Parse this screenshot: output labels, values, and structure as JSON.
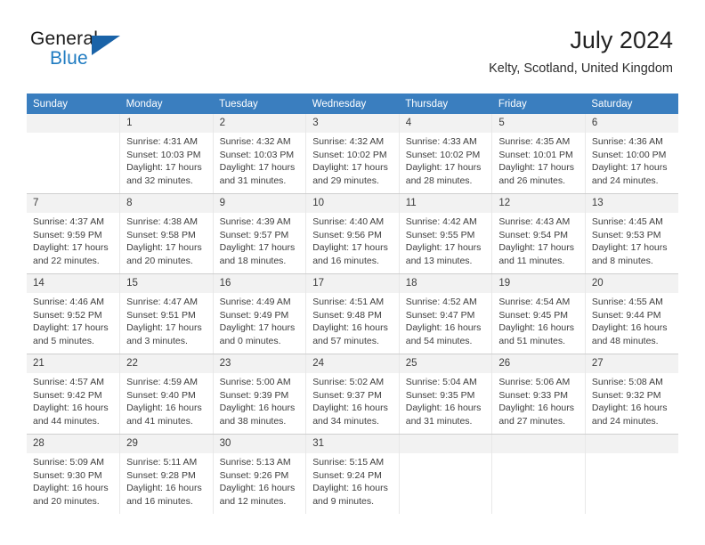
{
  "brand": {
    "name_part1": "General",
    "name_part2": "Blue",
    "logo_icon": "triangle-logo-icon",
    "accent_color": "#1f7bc1",
    "logo_triangle_color": "#1a63a8"
  },
  "header": {
    "title": "July 2024",
    "subtitle": "Kelty, Scotland, United Kingdom"
  },
  "calendar": {
    "header_bg_color": "#3a7ebf",
    "daynum_bg_color": "#f2f2f2",
    "weekday_headers": [
      "Sunday",
      "Monday",
      "Tuesday",
      "Wednesday",
      "Thursday",
      "Friday",
      "Saturday"
    ],
    "labels": {
      "sunrise": "Sunrise:",
      "sunset": "Sunset:",
      "daylight": "Daylight:"
    },
    "weeks": [
      [
        {
          "day": "",
          "blank": true
        },
        {
          "day": "1",
          "sunrise": "Sunrise: 4:31 AM",
          "sunset": "Sunset: 10:03 PM",
          "daylight_1": "Daylight: 17 hours",
          "daylight_2": "and 32 minutes."
        },
        {
          "day": "2",
          "sunrise": "Sunrise: 4:32 AM",
          "sunset": "Sunset: 10:03 PM",
          "daylight_1": "Daylight: 17 hours",
          "daylight_2": "and 31 minutes."
        },
        {
          "day": "3",
          "sunrise": "Sunrise: 4:32 AM",
          "sunset": "Sunset: 10:02 PM",
          "daylight_1": "Daylight: 17 hours",
          "daylight_2": "and 29 minutes."
        },
        {
          "day": "4",
          "sunrise": "Sunrise: 4:33 AM",
          "sunset": "Sunset: 10:02 PM",
          "daylight_1": "Daylight: 17 hours",
          "daylight_2": "and 28 minutes."
        },
        {
          "day": "5",
          "sunrise": "Sunrise: 4:35 AM",
          "sunset": "Sunset: 10:01 PM",
          "daylight_1": "Daylight: 17 hours",
          "daylight_2": "and 26 minutes."
        },
        {
          "day": "6",
          "sunrise": "Sunrise: 4:36 AM",
          "sunset": "Sunset: 10:00 PM",
          "daylight_1": "Daylight: 17 hours",
          "daylight_2": "and 24 minutes."
        }
      ],
      [
        {
          "day": "7",
          "sunrise": "Sunrise: 4:37 AM",
          "sunset": "Sunset: 9:59 PM",
          "daylight_1": "Daylight: 17 hours",
          "daylight_2": "and 22 minutes."
        },
        {
          "day": "8",
          "sunrise": "Sunrise: 4:38 AM",
          "sunset": "Sunset: 9:58 PM",
          "daylight_1": "Daylight: 17 hours",
          "daylight_2": "and 20 minutes."
        },
        {
          "day": "9",
          "sunrise": "Sunrise: 4:39 AM",
          "sunset": "Sunset: 9:57 PM",
          "daylight_1": "Daylight: 17 hours",
          "daylight_2": "and 18 minutes."
        },
        {
          "day": "10",
          "sunrise": "Sunrise: 4:40 AM",
          "sunset": "Sunset: 9:56 PM",
          "daylight_1": "Daylight: 17 hours",
          "daylight_2": "and 16 minutes."
        },
        {
          "day": "11",
          "sunrise": "Sunrise: 4:42 AM",
          "sunset": "Sunset: 9:55 PM",
          "daylight_1": "Daylight: 17 hours",
          "daylight_2": "and 13 minutes."
        },
        {
          "day": "12",
          "sunrise": "Sunrise: 4:43 AM",
          "sunset": "Sunset: 9:54 PM",
          "daylight_1": "Daylight: 17 hours",
          "daylight_2": "and 11 minutes."
        },
        {
          "day": "13",
          "sunrise": "Sunrise: 4:45 AM",
          "sunset": "Sunset: 9:53 PM",
          "daylight_1": "Daylight: 17 hours",
          "daylight_2": "and 8 minutes."
        }
      ],
      [
        {
          "day": "14",
          "sunrise": "Sunrise: 4:46 AM",
          "sunset": "Sunset: 9:52 PM",
          "daylight_1": "Daylight: 17 hours",
          "daylight_2": "and 5 minutes."
        },
        {
          "day": "15",
          "sunrise": "Sunrise: 4:47 AM",
          "sunset": "Sunset: 9:51 PM",
          "daylight_1": "Daylight: 17 hours",
          "daylight_2": "and 3 minutes."
        },
        {
          "day": "16",
          "sunrise": "Sunrise: 4:49 AM",
          "sunset": "Sunset: 9:49 PM",
          "daylight_1": "Daylight: 17 hours",
          "daylight_2": "and 0 minutes."
        },
        {
          "day": "17",
          "sunrise": "Sunrise: 4:51 AM",
          "sunset": "Sunset: 9:48 PM",
          "daylight_1": "Daylight: 16 hours",
          "daylight_2": "and 57 minutes."
        },
        {
          "day": "18",
          "sunrise": "Sunrise: 4:52 AM",
          "sunset": "Sunset: 9:47 PM",
          "daylight_1": "Daylight: 16 hours",
          "daylight_2": "and 54 minutes."
        },
        {
          "day": "19",
          "sunrise": "Sunrise: 4:54 AM",
          "sunset": "Sunset: 9:45 PM",
          "daylight_1": "Daylight: 16 hours",
          "daylight_2": "and 51 minutes."
        },
        {
          "day": "20",
          "sunrise": "Sunrise: 4:55 AM",
          "sunset": "Sunset: 9:44 PM",
          "daylight_1": "Daylight: 16 hours",
          "daylight_2": "and 48 minutes."
        }
      ],
      [
        {
          "day": "21",
          "sunrise": "Sunrise: 4:57 AM",
          "sunset": "Sunset: 9:42 PM",
          "daylight_1": "Daylight: 16 hours",
          "daylight_2": "and 44 minutes."
        },
        {
          "day": "22",
          "sunrise": "Sunrise: 4:59 AM",
          "sunset": "Sunset: 9:40 PM",
          "daylight_1": "Daylight: 16 hours",
          "daylight_2": "and 41 minutes."
        },
        {
          "day": "23",
          "sunrise": "Sunrise: 5:00 AM",
          "sunset": "Sunset: 9:39 PM",
          "daylight_1": "Daylight: 16 hours",
          "daylight_2": "and 38 minutes."
        },
        {
          "day": "24",
          "sunrise": "Sunrise: 5:02 AM",
          "sunset": "Sunset: 9:37 PM",
          "daylight_1": "Daylight: 16 hours",
          "daylight_2": "and 34 minutes."
        },
        {
          "day": "25",
          "sunrise": "Sunrise: 5:04 AM",
          "sunset": "Sunset: 9:35 PM",
          "daylight_1": "Daylight: 16 hours",
          "daylight_2": "and 31 minutes."
        },
        {
          "day": "26",
          "sunrise": "Sunrise: 5:06 AM",
          "sunset": "Sunset: 9:33 PM",
          "daylight_1": "Daylight: 16 hours",
          "daylight_2": "and 27 minutes."
        },
        {
          "day": "27",
          "sunrise": "Sunrise: 5:08 AM",
          "sunset": "Sunset: 9:32 PM",
          "daylight_1": "Daylight: 16 hours",
          "daylight_2": "and 24 minutes."
        }
      ],
      [
        {
          "day": "28",
          "sunrise": "Sunrise: 5:09 AM",
          "sunset": "Sunset: 9:30 PM",
          "daylight_1": "Daylight: 16 hours",
          "daylight_2": "and 20 minutes."
        },
        {
          "day": "29",
          "sunrise": "Sunrise: 5:11 AM",
          "sunset": "Sunset: 9:28 PM",
          "daylight_1": "Daylight: 16 hours",
          "daylight_2": "and 16 minutes."
        },
        {
          "day": "30",
          "sunrise": "Sunrise: 5:13 AM",
          "sunset": "Sunset: 9:26 PM",
          "daylight_1": "Daylight: 16 hours",
          "daylight_2": "and 12 minutes."
        },
        {
          "day": "31",
          "sunrise": "Sunrise: 5:15 AM",
          "sunset": "Sunset: 9:24 PM",
          "daylight_1": "Daylight: 16 hours",
          "daylight_2": "and 9 minutes."
        },
        {
          "day": "",
          "blank": true
        },
        {
          "day": "",
          "blank": true
        },
        {
          "day": "",
          "blank": true
        }
      ]
    ]
  }
}
